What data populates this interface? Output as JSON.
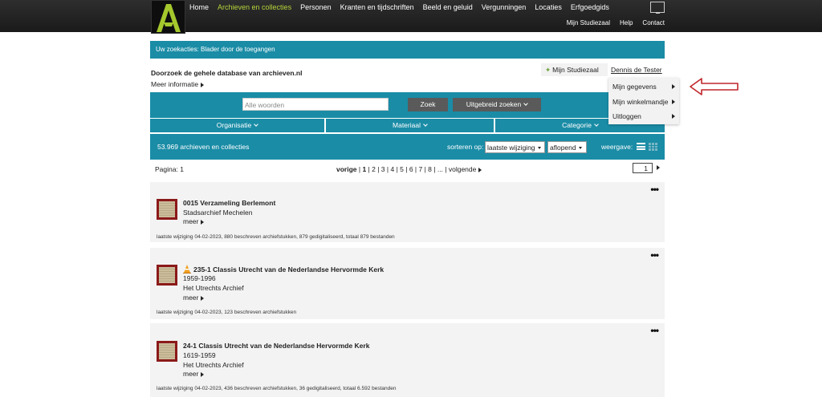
{
  "topbar": {
    "logo_letter": "A",
    "nav": [
      {
        "label": "Home",
        "active": false
      },
      {
        "label": "Archieven en collecties",
        "active": true
      },
      {
        "label": "Personen",
        "active": false
      },
      {
        "label": "Kranten en tijdschriften",
        "active": false
      },
      {
        "label": "Beeld en geluid",
        "active": false
      },
      {
        "label": "Vergunningen",
        "active": false
      },
      {
        "label": "Locaties",
        "active": false
      },
      {
        "label": "Erfgoedgids",
        "active": false
      }
    ],
    "subnav": [
      "Mijn Studiezaal",
      "Help",
      "Contact"
    ],
    "active_color": "#b6d43a"
  },
  "search_actions": "Uw zoekacties: Blader door de toegangen",
  "db_title": "Doorzoek de gehele database van archieven.nl",
  "more_info": "Meer informatie",
  "studiezaal": "Mijn Studiezaal",
  "user": "Dennis de Tester",
  "dropdown": [
    "Mijn gegevens",
    "Mijn winkelmandje",
    "Uitloggen"
  ],
  "search": {
    "placeholder": "Alle woorden",
    "zoek": "Zoek",
    "uitgebreid": "Uitgebreid zoeken"
  },
  "categories": [
    "Organisatie",
    "Materiaal",
    "Categorie"
  ],
  "results": {
    "count": "53.969 archieven en collecties",
    "sort_label": "sorteren op:",
    "sort_value": "laatste wijziging",
    "order_value": "aflopend",
    "view_label": "weergave:"
  },
  "pagination": {
    "label": "Pagina: 1",
    "prev": "vorige",
    "pages": [
      "1",
      "2",
      "3",
      "4",
      "5",
      "6",
      "7",
      "8",
      "..."
    ],
    "current": "1",
    "next": "volgende",
    "page_input": "1"
  },
  "items": [
    {
      "title": "0015 Verzameling Berlemont",
      "lines": [
        "Stadsarchief Mechelen"
      ],
      "more": "meer",
      "meta": "laatste wijziging 04-02-2023, 880 beschreven archiefstukken, 879 gedigitaliseerd, totaal 879 bestanden",
      "warning": false
    },
    {
      "title": "235-1 Classis Utrecht van de Nederlandse Hervormde Kerk",
      "lines": [
        "1959-1996",
        "Het Utrechts Archief"
      ],
      "more": "meer",
      "meta": "laatste wijziging 04-02-2023, 123 beschreven archiefstukken",
      "warning": true
    },
    {
      "title": "24-1 Classis Utrecht van de Nederlandse Hervormde Kerk",
      "lines": [
        "1619-1959",
        "Het Utrechts Archief"
      ],
      "more": "meer",
      "meta": "laatste wijziging 04-02-2023, 436 beschreven archiefstukken, 36 gedigitaliseerd, totaal 6.592 bestanden",
      "warning": false
    }
  ],
  "colors": {
    "teal": "#1a8ca6",
    "annotation_red": "#c0262b",
    "card_bg": "#f3f3f3"
  },
  "icons": [
    "logo-a-icon",
    "screen-icon",
    "star-icon",
    "list-view-icon",
    "grid-view-icon",
    "more-dots-icon",
    "warning-cone-icon",
    "red-arrow-annotation"
  ]
}
